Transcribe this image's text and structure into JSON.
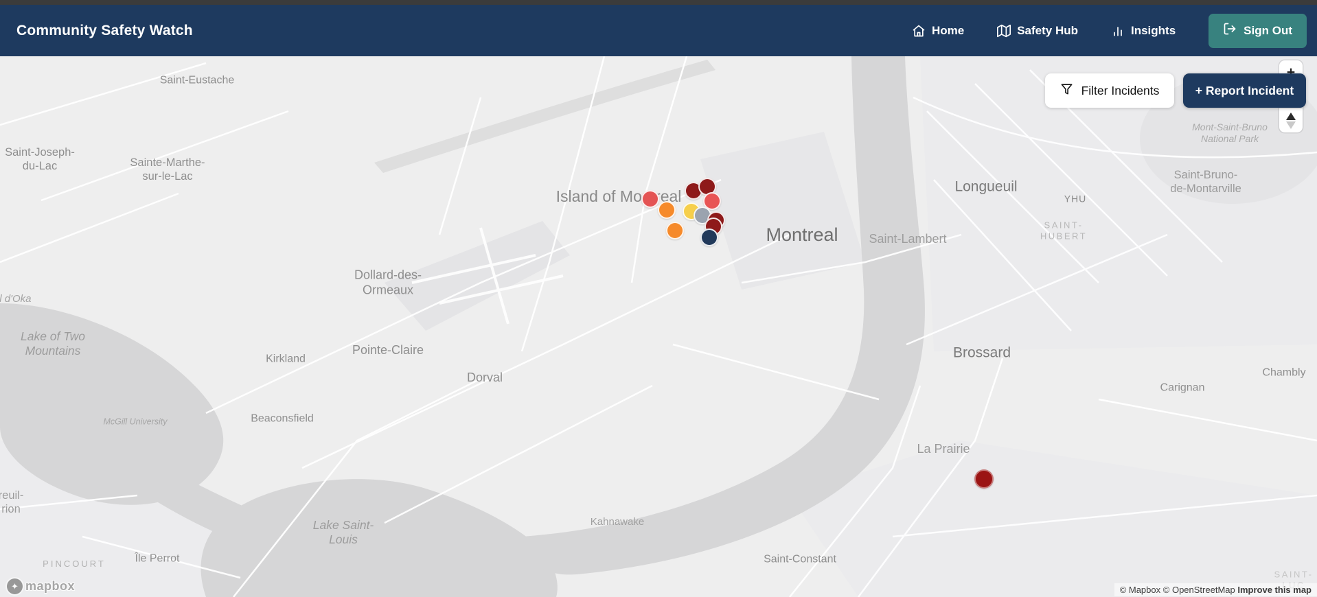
{
  "app": {
    "title": "Community Safety Watch"
  },
  "nav": {
    "items": [
      {
        "label": "Home",
        "icon": "home-icon"
      },
      {
        "label": "Safety Hub",
        "icon": "map-icon"
      },
      {
        "label": "Insights",
        "icon": "bar-chart-icon"
      }
    ],
    "sign_out_label": "Sign Out"
  },
  "colors": {
    "header_bg": "#1e3a5f",
    "sign_out_teal": "#38827f",
    "report_button_navy": "#1e3a5f",
    "map_land": "#eeeeee",
    "map_water": "#d6d6d7"
  },
  "map_controls": {
    "filter_label": "Filter Incidents",
    "report_label": "+ Report Incident",
    "zoom_in": "+",
    "zoom_out": "−"
  },
  "map": {
    "labels": [
      {
        "text": "Saint-Eustache"
      },
      {
        "text": "Saint-Joseph-\ndu-Lac"
      },
      {
        "text": "Sainte-Marthe-\nsur-le-Lac"
      },
      {
        "text": "nal d'Oka"
      },
      {
        "text": "Lake of Two\nMountains"
      },
      {
        "text": "Dollard-des-\nOrmeaux"
      },
      {
        "text": "Kirkland"
      },
      {
        "text": "Pointe-Claire"
      },
      {
        "text": "Dorval"
      },
      {
        "text": "Beaconsfield"
      },
      {
        "text": "McGill University"
      },
      {
        "text": "Île Perrot"
      },
      {
        "text": "PINCOURT"
      },
      {
        "text": "reuil-\nrion"
      },
      {
        "text": "Lake Saint-\nLouis"
      },
      {
        "text": "Kahnawake"
      },
      {
        "text": "Saint-Constant"
      },
      {
        "text": "Island of Montreal"
      },
      {
        "text": "Montreal"
      },
      {
        "text": "Saint-Lambert"
      },
      {
        "text": "Longueuil"
      },
      {
        "text": "YHU"
      },
      {
        "text": "SAINT-\nHUBERT"
      },
      {
        "text": "Mont-Saint-Bruno\nNational Park"
      },
      {
        "text": "Saint-Bruno-\nde-Montarville"
      },
      {
        "text": "Brossard"
      },
      {
        "text": "Carignan"
      },
      {
        "text": "Chambly"
      },
      {
        "text": "La Prairie"
      },
      {
        "text": "SAINT-LUC"
      }
    ],
    "markers": [
      {
        "color": "#e45454"
      },
      {
        "color": "#8e1a1a"
      },
      {
        "color": "#8e1a1a"
      },
      {
        "color": "#e85555"
      },
      {
        "color": "#f68a2a"
      },
      {
        "color": "#f6cf4b"
      },
      {
        "color": "#9ba3af"
      },
      {
        "color": "#8e1a1a"
      },
      {
        "color": "#8e1a1a"
      },
      {
        "color": "#f68a2a"
      },
      {
        "color": "#21395a"
      },
      {
        "color": "#9b1414"
      }
    ],
    "attribution": {
      "mapbox": "© Mapbox",
      "osm": "© OpenStreetMap",
      "improve": "Improve this map",
      "logo_word": "mapbox"
    }
  }
}
